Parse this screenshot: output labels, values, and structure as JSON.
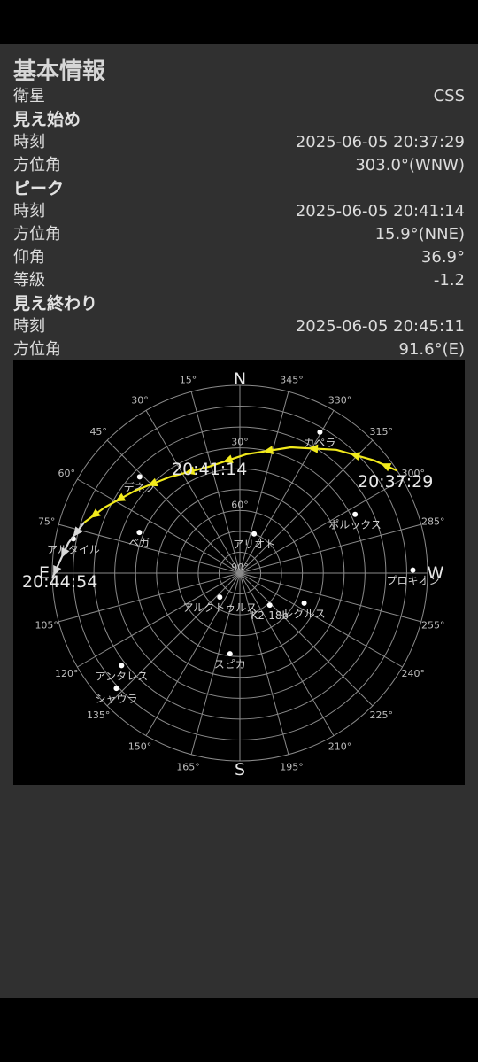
{
  "header": {
    "title": "基本情報"
  },
  "satellite": {
    "label": "衛星",
    "value": "CSS"
  },
  "start": {
    "heading": "見え始め",
    "time_label": "時刻",
    "time_value": "2025-06-05 20:37:29",
    "azimuth_label": "方位角",
    "azimuth_value": "303.0°(WNW)"
  },
  "peak": {
    "heading": "ピーク",
    "time_label": "時刻",
    "time_value": "2025-06-05 20:41:14",
    "azimuth_label": "方位角",
    "azimuth_value": "15.9°(NNE)",
    "elevation_label": "仰角",
    "elevation_value": "36.9°",
    "magnitude_label": "等級",
    "magnitude_value": "-1.2"
  },
  "end": {
    "heading": "見え終わり",
    "time_label": "時刻",
    "time_value": "2025-06-05 20:45:11",
    "azimuth_label": "方位角",
    "azimuth_value": "91.6°(E)"
  },
  "sky_chart": {
    "cardinals": {
      "N": "N",
      "S": "S",
      "E": "E",
      "W": "W"
    },
    "elevation_labels": [
      {
        "text": "30°",
        "alt": 30
      },
      {
        "text": "60°",
        "alt": 60
      },
      {
        "text": "90°",
        "alt": 90
      }
    ],
    "azimuth_labels": [
      "15°",
      "30°",
      "45°",
      "60°",
      "75°",
      "105°",
      "120°",
      "135°",
      "150°",
      "165°",
      "195°",
      "210°",
      "225°",
      "240°",
      "255°",
      "285°",
      "300°",
      "315°",
      "330°",
      "345°"
    ],
    "stars": [
      {
        "name": "カペラ",
        "az": 330.4,
        "alt": 12.3
      },
      {
        "name": "デネブ",
        "az": 46.2,
        "alt": 23.4
      },
      {
        "name": "ベガ",
        "az": 68.0,
        "alt": 38.0
      },
      {
        "name": "アルタイル",
        "az": 78.4,
        "alt": 8.5
      },
      {
        "name": "ポルックス",
        "az": 297.0,
        "alt": 28.0
      },
      {
        "name": "プロキオン",
        "az": 271.0,
        "alt": 7.0
      },
      {
        "name": "アリオト",
        "az": 340.0,
        "alt": 70.0
      },
      {
        "name": "アルクトゥルス",
        "az": 140.0,
        "alt": 75.0
      },
      {
        "name": "レグルス",
        "az": 245.0,
        "alt": 56.0
      },
      {
        "name": "K2-18b",
        "az": 223.0,
        "alt": 69.0
      },
      {
        "name": "スピカ",
        "az": 173.0,
        "alt": 51.0
      },
      {
        "name": "アンタレス",
        "az": 128.0,
        "alt": 18.0
      },
      {
        "name": "シャウラ",
        "az": 133.0,
        "alt": 9.0
      }
    ],
    "pass_visible": [
      {
        "az": 303.0,
        "alt": 0.0
      },
      {
        "az": 310.0,
        "alt": 6.0
      },
      {
        "az": 322.0,
        "alt": 15.0
      },
      {
        "az": 338.0,
        "alt": 25.0
      },
      {
        "az": 357.0,
        "alt": 33.0
      },
      {
        "az": 15.9,
        "alt": 36.9
      },
      {
        "az": 36.0,
        "alt": 33.0
      },
      {
        "az": 52.0,
        "alt": 26.0
      },
      {
        "az": 64.0,
        "alt": 18.0
      },
      {
        "az": 72.0,
        "alt": 11.5
      }
    ],
    "pass_shadow": [
      {
        "az": 72.0,
        "alt": 11.5
      },
      {
        "az": 80.0,
        "alt": 6.5
      },
      {
        "az": 87.0,
        "alt": 3.0
      },
      {
        "az": 91.6,
        "alt": 0.0
      }
    ],
    "time_labels": {
      "start": "20:37:29",
      "peak": "20:41:14",
      "shadow": "20:44:54"
    },
    "colors": {
      "visible": "#f2ea1c",
      "shadow": "#d8d8d8",
      "grid": "#8a8a8a",
      "label": "#bdbdbd"
    }
  }
}
